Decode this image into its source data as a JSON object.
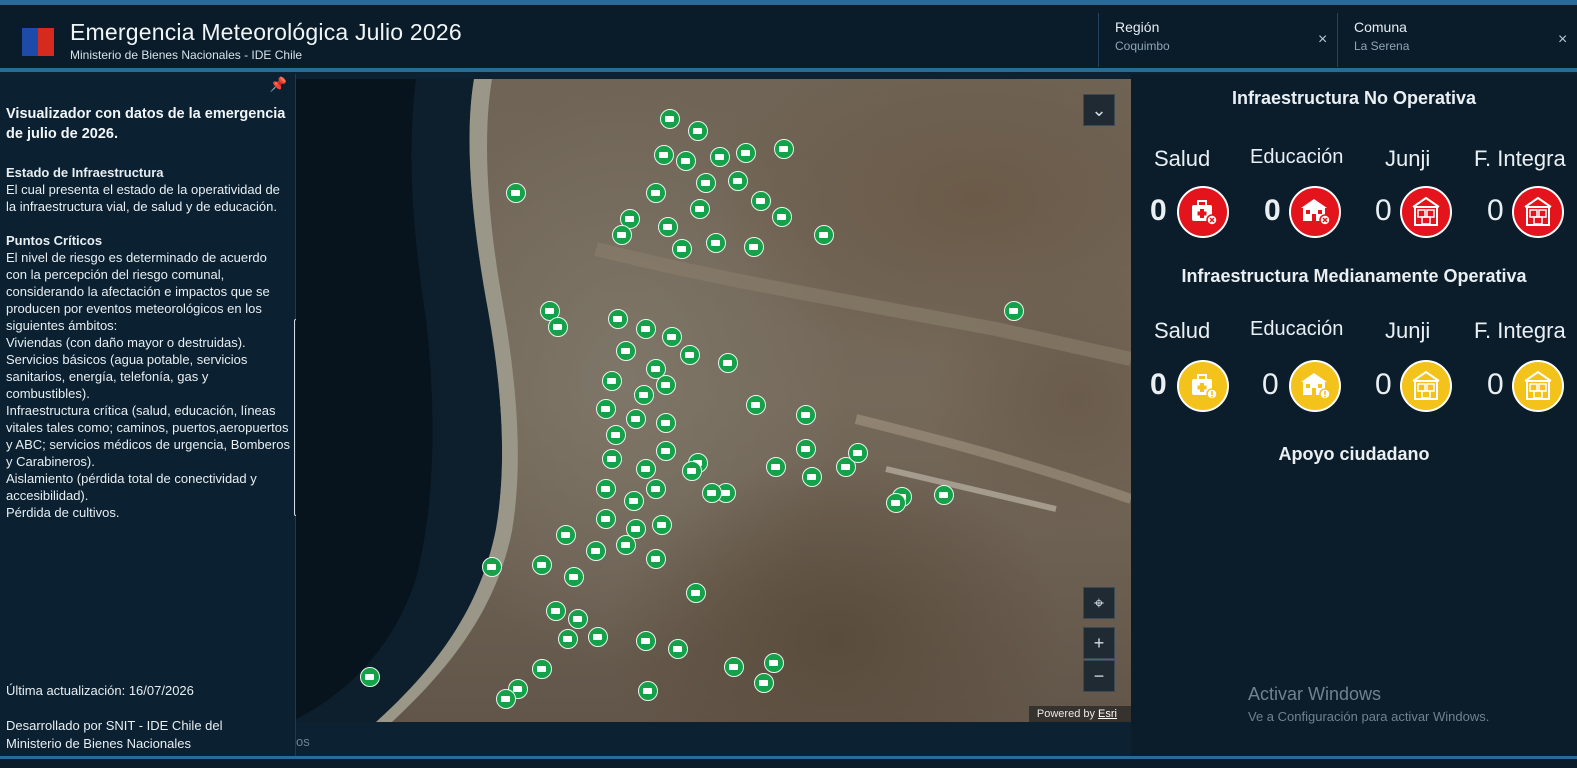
{
  "header": {
    "title": "Emergencia Meteorológica Julio 2026",
    "subtitle": "Ministerio de Bienes Nacionales - IDE Chile",
    "filters": [
      {
        "label": "Región",
        "value": "Coquimbo",
        "close": "×"
      },
      {
        "label": "Comuna",
        "value": "La Serena",
        "close": "×"
      }
    ]
  },
  "left_panel": {
    "pin": "📌",
    "title": "Visualizador con datos de la emergencia de julio de 2026.",
    "sections": [
      {
        "heading": "Estado de Infraestructura",
        "text": "El cual presenta el estado de la operatividad de la infraestructura vial, de salud y de educación."
      },
      {
        "heading": "Puntos Críticos",
        "text": "El nivel de riesgo es determinado de acuerdo con la percepción del riesgo comunal, considerando la afectación e impactos que se producen por eventos meteorológicos en los siguientes ámbitos:"
      }
    ],
    "items": [
      "Viviendas (con daño mayor o destruidas).",
      "Servicios básicos (agua potable, servicios sanitarios, energía, telefonía, gas y combustibles).",
      "Infraestructura crítica (salud, educación, líneas vitales tales como; caminos, puertos,aeropuertos y ABC; servicios médicos de urgencia, Bomberos y Carabineros).",
      "Aislamiento (pérdida total de conectividad y accesibilidad).",
      "Pérdida de cultivos."
    ],
    "updated": "Última actualización: 16/07/2026",
    "developed": "Desarrollado por SNIT - IDE Chile del Ministerio de Bienes Nacionales",
    "collapse_icon": "◂"
  },
  "map": {
    "controls": {
      "expand": "⌄",
      "locate": "⌖",
      "zoom_in": "+",
      "zoom_out": "−"
    },
    "attribution_prefix": "Powered by ",
    "attribution_link": "Esri"
  },
  "right_panel": {
    "sections": [
      {
        "title": "Infraestructura No Operativa",
        "status_color": "#e3141b",
        "categories": [
          {
            "label": "Salud",
            "value": "0",
            "icon": "medical-kit-x-icon"
          },
          {
            "label": "Educación",
            "value": "0",
            "icon": "school-x-icon"
          },
          {
            "label": "Junji",
            "value": "0",
            "icon": "abc-blocks-icon"
          },
          {
            "label": "F. Integra",
            "value": "0",
            "icon": "abc-blocks-icon"
          }
        ]
      },
      {
        "title": "Infraestructura Medianamente Operativa",
        "status_color": "#f3c21b",
        "categories": [
          {
            "label": "Salud",
            "value": "0",
            "icon": "medical-kit-warning-icon"
          },
          {
            "label": "Educación",
            "value": "0",
            "icon": "school-warning-icon"
          },
          {
            "label": "Junji",
            "value": "0",
            "icon": "abc-blocks-icon"
          },
          {
            "label": "F. Integra",
            "value": "0",
            "icon": "abc-blocks-icon"
          }
        ]
      },
      {
        "title": "Apoyo ciudadano"
      }
    ]
  },
  "watermark": {
    "line1": "Activar Windows",
    "line2": "Ve a Configuración para activar Windows."
  },
  "bottom_text": "os"
}
